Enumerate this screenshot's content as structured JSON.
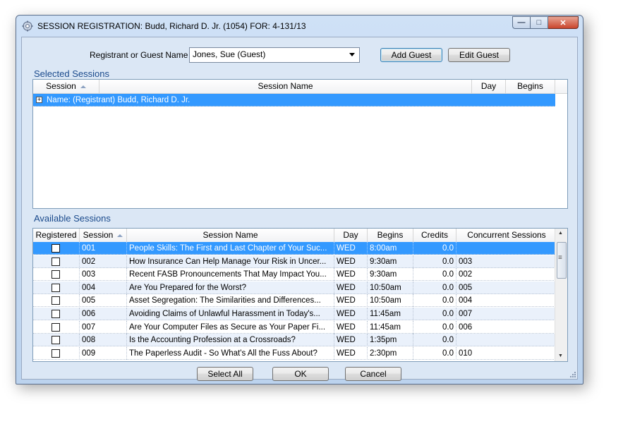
{
  "window": {
    "title": "SESSION REGISTRATION: Budd, Richard D. Jr. (1054) FOR: 4-131/13",
    "min_glyph": "—",
    "max_glyph": "□",
    "close_glyph": "✕"
  },
  "registrant": {
    "label": "Registrant or Guest Name",
    "selected": "Jones, Sue (Guest)"
  },
  "buttons": {
    "add_guest": "Add Guest",
    "edit_guest": "Edit Guest",
    "select_all": "Select All",
    "ok": "OK",
    "cancel": "Cancel"
  },
  "selected_sessions": {
    "title": "Selected Sessions",
    "columns": [
      "Session",
      "Session Name",
      "Day",
      "Begins"
    ],
    "group_row": "Name: (Registrant) Budd, Richard D. Jr."
  },
  "available_sessions": {
    "title": "Available Sessions",
    "columns": [
      "Registered",
      "Session",
      "Session Name",
      "Day",
      "Begins",
      "Credits",
      "Concurrent Sessions"
    ],
    "rows": [
      {
        "registered": false,
        "session": "001",
        "name": "People Skills: The First and Last Chapter of Your Suc...",
        "day": "WED",
        "begins": "8:00am",
        "credits": "0.0",
        "concurrent": ""
      },
      {
        "registered": false,
        "session": "002",
        "name": "How Insurance Can Help Manage Your Risk in Uncer...",
        "day": "WED",
        "begins": "9:30am",
        "credits": "0.0",
        "concurrent": "003"
      },
      {
        "registered": false,
        "session": "003",
        "name": "Recent FASB Pronouncements That May Impact You...",
        "day": "WED",
        "begins": "9:30am",
        "credits": "0.0",
        "concurrent": "002"
      },
      {
        "registered": false,
        "session": "004",
        "name": "Are You Prepared for the Worst?",
        "day": "WED",
        "begins": "10:50am",
        "credits": "0.0",
        "concurrent": "005"
      },
      {
        "registered": false,
        "session": "005",
        "name": "Asset Segregation: The Similarities and Differences...",
        "day": "WED",
        "begins": "10:50am",
        "credits": "0.0",
        "concurrent": "004"
      },
      {
        "registered": false,
        "session": "006",
        "name": "Avoiding Claims of Unlawful Harassment in Today's...",
        "day": "WED",
        "begins": "11:45am",
        "credits": "0.0",
        "concurrent": "007"
      },
      {
        "registered": false,
        "session": "007",
        "name": "Are Your Computer Files as Secure as Your Paper Fi...",
        "day": "WED",
        "begins": "11:45am",
        "credits": "0.0",
        "concurrent": "006"
      },
      {
        "registered": false,
        "session": "008",
        "name": "Is the Accounting Profession at a Crossroads?",
        "day": "WED",
        "begins": "1:35pm",
        "credits": "0.0",
        "concurrent": ""
      },
      {
        "registered": false,
        "session": "009",
        "name": "The Paperless Audit - So What's All the Fuss About?",
        "day": "WED",
        "begins": "2:30pm",
        "credits": "0.0",
        "concurrent": "010"
      }
    ]
  },
  "scrollbar": {
    "up": "▲",
    "down": "▼",
    "grip": "≡"
  },
  "colors": {
    "selection": "#3399ff",
    "section_title": "#1a4a8c",
    "client_bg": "#dbe7f5"
  }
}
